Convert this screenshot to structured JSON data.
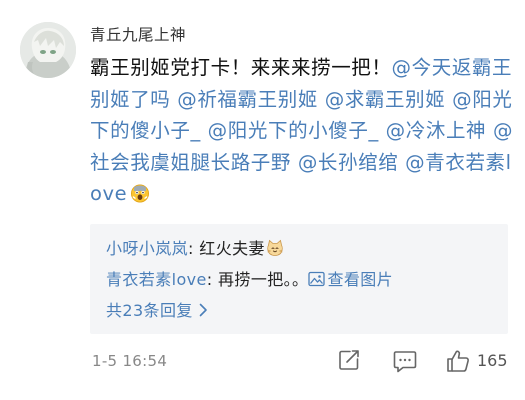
{
  "comment": {
    "username": "青丘九尾上神",
    "text_intro": "霸王别姬党打卡！来来来捞一把！",
    "mentions": [
      "@今天返霸王别姬了吗",
      "@祈福霸王别姬",
      "@求霸王别姬",
      "@阳光下的傻小子_",
      "@阳光下的小傻子_",
      "@冷沐上神",
      "@社会我虞姐腿长路子野",
      "@长孙绾绾",
      "@青衣若素love"
    ],
    "emoji": "fearful-face-emoji",
    "timestamp": "1-5 16:54"
  },
  "replies": [
    {
      "name": "小呀小岚岚",
      "sep": ": ",
      "text": "红火夫妻",
      "emoji": "cat-face-emoji"
    },
    {
      "name": "青衣若素love",
      "sep": ": ",
      "text": "再捞一把。。",
      "link_label": "查看图片"
    }
  ],
  "replies_more": "共23条回复",
  "actions": {
    "like_count": "165"
  },
  "colors": {
    "link": "#4a7eb8",
    "reply_bg": "#f4f5f7",
    "meta": "#888888"
  }
}
